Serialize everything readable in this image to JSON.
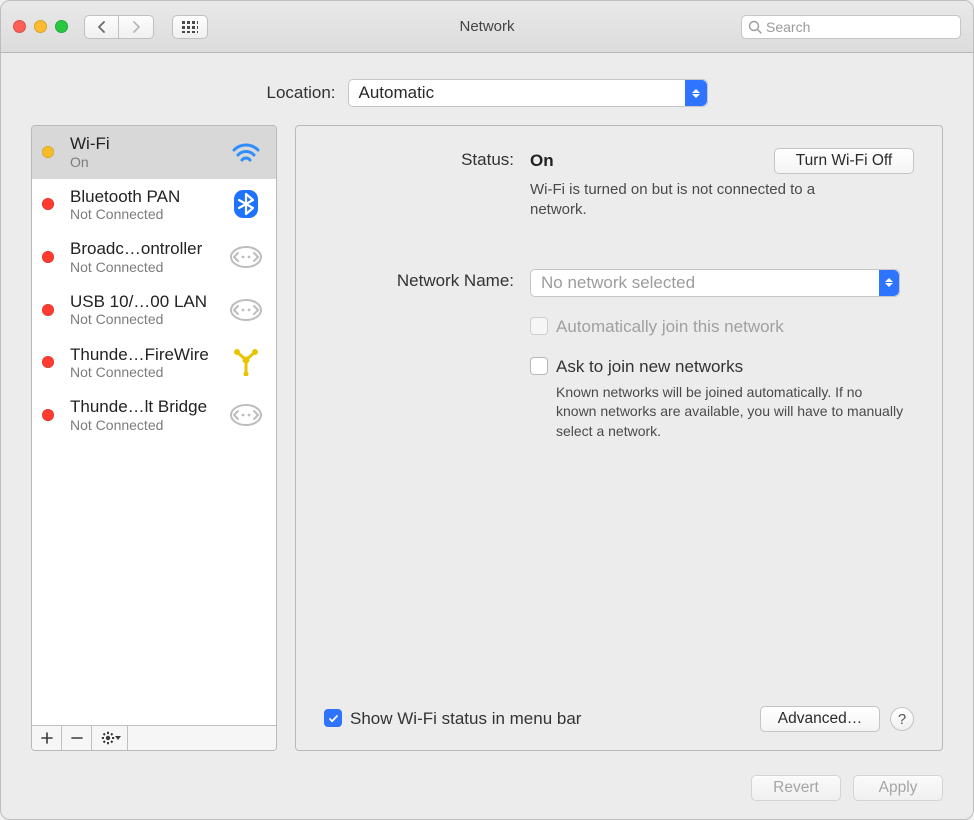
{
  "window": {
    "title": "Network",
    "search_placeholder": "Search"
  },
  "location": {
    "label": "Location:",
    "value": "Automatic"
  },
  "sidebar": {
    "items": [
      {
        "name": "Wi-Fi",
        "status_text": "On",
        "status_color": "amber",
        "icon": "wifi",
        "selected": true
      },
      {
        "name": "Bluetooth PAN",
        "status_text": "Not Connected",
        "status_color": "red",
        "icon": "bluetooth",
        "selected": false
      },
      {
        "name": "Broadc…ontroller",
        "status_text": "Not Connected",
        "status_color": "red",
        "icon": "ethernet",
        "selected": false
      },
      {
        "name": "USB 10/…00 LAN",
        "status_text": "Not Connected",
        "status_color": "red",
        "icon": "ethernet",
        "selected": false
      },
      {
        "name": "Thunde…FireWire",
        "status_text": "Not Connected",
        "status_color": "red",
        "icon": "firewire",
        "selected": false
      },
      {
        "name": "Thunde…lt Bridge",
        "status_text": "Not Connected",
        "status_color": "red",
        "icon": "ethernet",
        "selected": false
      }
    ]
  },
  "details": {
    "status_label": "Status:",
    "status_value": "On",
    "turn_off_label": "Turn Wi-Fi Off",
    "status_desc": "Wi-Fi is turned on but is not connected to a network.",
    "network_name_label": "Network Name:",
    "network_name_value": "No network selected",
    "auto_join_label": "Automatically join this network",
    "auto_join_checked": false,
    "auto_join_disabled": true,
    "ask_label": "Ask to join new networks",
    "ask_checked": false,
    "ask_desc": "Known networks will be joined automatically. If no known networks are available, you will have to manually select a network.",
    "show_status_label": "Show Wi-Fi status in menu bar",
    "show_status_checked": true,
    "advanced_label": "Advanced…"
  },
  "footer": {
    "revert": "Revert",
    "apply": "Apply"
  }
}
